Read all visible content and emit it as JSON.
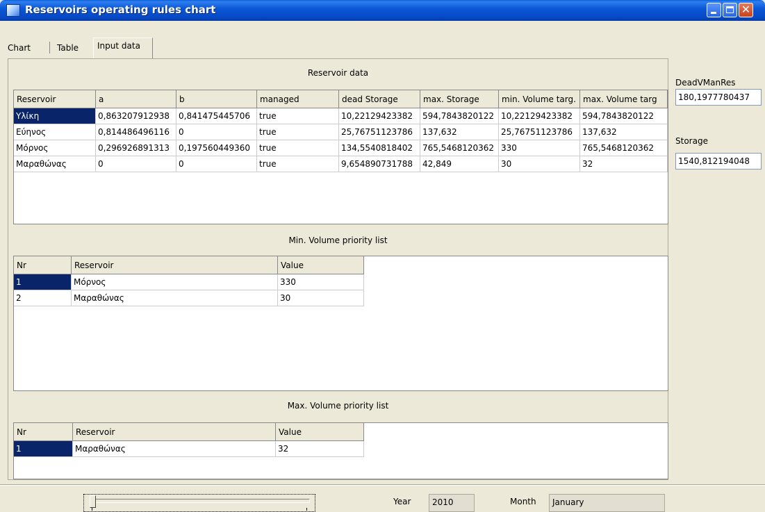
{
  "window": {
    "title": "Reservoirs operating rules chart"
  },
  "tabs": [
    {
      "label": "Chart"
    },
    {
      "label": "Table"
    },
    {
      "label": "Input data"
    }
  ],
  "reservoir_data": {
    "title": "Reservoir data",
    "columns": [
      "Reservoir",
      "a",
      "b",
      "managed",
      "dead Storage",
      "max. Storage",
      "min. Volume targ.",
      "max. Volume targ"
    ],
    "rows": [
      [
        "Υλίκη",
        "0,863207912938",
        "0,841475445706",
        "true",
        "10,22129423382",
        "594,7843820122",
        "10,22129423382",
        "594,7843820122"
      ],
      [
        "Εύηνος",
        "0,814486496116",
        "0",
        "true",
        "25,76751123786",
        "137,632",
        "25,76751123786",
        "137,632"
      ],
      [
        "Μόρνος",
        "0,296926891313",
        "0,197560449360",
        "true",
        "134,5540818402",
        "765,5468120362",
        "330",
        "765,5468120362"
      ],
      [
        "Μαραθώνας",
        "0",
        "0",
        "true",
        "9,654890731788",
        "42,849",
        "30",
        "32"
      ]
    ]
  },
  "min_volume": {
    "title": "Min. Volume priority list",
    "columns": [
      "Nr",
      "Reservoir",
      "Value"
    ],
    "rows": [
      [
        "1",
        "Μόρνος",
        "330"
      ],
      [
        "2",
        "Μαραθώνας",
        "30"
      ]
    ]
  },
  "max_volume": {
    "title": "Max. Volume priority list",
    "columns": [
      "Nr",
      "Reservoir",
      "Value"
    ],
    "rows": [
      [
        "1",
        "Μαραθώνας",
        "32"
      ]
    ]
  },
  "side": {
    "dead_label": "DeadVManRes",
    "dead_value": "180,1977780437",
    "storage_label": "Storage",
    "storage_value": "1540,812194048"
  },
  "bottom": {
    "year_label": "Year",
    "year_value": "2010",
    "month_label": "Month",
    "month_value": "January",
    "slider_position": 0
  },
  "colors": {
    "selection": "#0a246a",
    "titlebar": "#0a58d6",
    "background": "#ece9d8"
  }
}
